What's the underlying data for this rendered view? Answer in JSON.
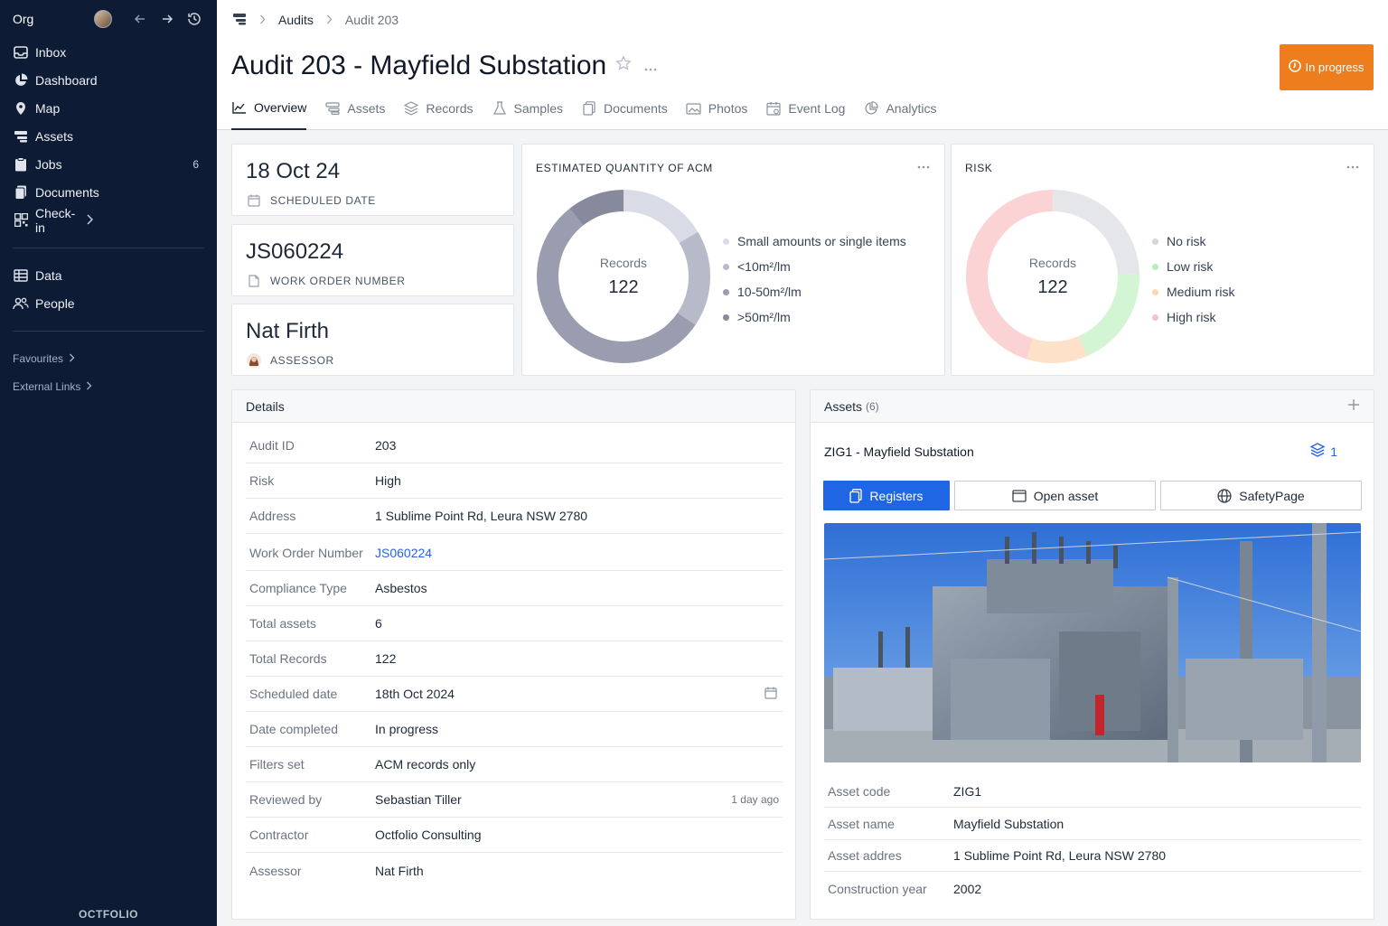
{
  "sidebar": {
    "org": "Org",
    "items": [
      {
        "label": "Inbox",
        "icon": "inbox-icon"
      },
      {
        "label": "Dashboard",
        "icon": "pie-chart-icon"
      },
      {
        "label": "Map",
        "icon": "map-pin-icon"
      },
      {
        "label": "Assets",
        "icon": "assets-icon"
      },
      {
        "label": "Jobs",
        "icon": "clipboard-icon",
        "count": "6"
      },
      {
        "label": "Documents",
        "icon": "documents-icon"
      },
      {
        "label": "Check-in",
        "icon": "qr-code-icon"
      }
    ],
    "items2": [
      {
        "label": "Data",
        "icon": "table-icon"
      },
      {
        "label": "People",
        "icon": "people-icon"
      }
    ],
    "favourites": "Favourites",
    "external_links": "External Links",
    "logo": "OCTFOLIO"
  },
  "breadcrumb": {
    "parent": "Audits",
    "current": "Audit 203"
  },
  "page": {
    "title": "Audit 203 - Mayfield Substation",
    "status": "In progress",
    "status_color": "#ee7d1d"
  },
  "tabs": [
    {
      "label": "Overview",
      "icon": "chart-icon",
      "active": true
    },
    {
      "label": "Assets",
      "icon": "assets-icon"
    },
    {
      "label": "Records",
      "icon": "layers-icon"
    },
    {
      "label": "Samples",
      "icon": "flask-icon"
    },
    {
      "label": "Documents",
      "icon": "documents-icon"
    },
    {
      "label": "Photos",
      "icon": "photos-icon"
    },
    {
      "label": "Event Log",
      "icon": "calendar-icon"
    },
    {
      "label": "Analytics",
      "icon": "analytics-icon"
    }
  ],
  "kpis": {
    "scheduled": {
      "value": "18 Oct 24",
      "label": "SCHEDULED DATE"
    },
    "work_order": {
      "value": "JS060224",
      "label": "WORK ORDER NUMBER"
    },
    "assessor": {
      "value": "Nat Firth",
      "label": "ASSESSOR"
    }
  },
  "chart_data": [
    {
      "type": "pie",
      "title": "ESTIMATED QUANTITY OF ACM",
      "center_label": "Records",
      "center_value": "122",
      "categories": [
        "Small amounts or single items",
        "<10m²/lm",
        "10-50m²/lm",
        ">50m²/lm"
      ],
      "values": [
        20,
        22,
        67,
        13
      ],
      "colors": [
        "#d9dbe6",
        "#b7bac8",
        "#9a9db0",
        "#868a9c"
      ]
    },
    {
      "type": "pie",
      "title": "RISK",
      "center_label": "Records",
      "center_value": "122",
      "categories": [
        "No risk",
        "Low risk",
        "Medium risk",
        "High risk"
      ],
      "values": [
        30,
        23,
        14,
        55
      ],
      "colors": [
        "#e5e6ea",
        "#d3f5d3",
        "#fde2c9",
        "#fbd3d4"
      ],
      "legend_colors": [
        "#d3d5dc",
        "#b5efb5",
        "#fcd7b1",
        "#f8c1c3"
      ]
    }
  ],
  "details": {
    "title": "Details",
    "rows": [
      {
        "k": "Audit ID",
        "v": "203"
      },
      {
        "k": "Risk",
        "v": "High"
      },
      {
        "k": "Address",
        "v": "1 Sublime Point Rd, Leura NSW 2780"
      },
      {
        "k": "Work Order Number",
        "v": "JS060224"
      },
      {
        "k": "Compliance Type",
        "v": "Asbestos"
      },
      {
        "k": "Total assets",
        "v": "6"
      },
      {
        "k": "Total Records",
        "v": "122"
      },
      {
        "k": "Scheduled date",
        "v": "18th Oct 2024"
      },
      {
        "k": "Date completed",
        "v": "In progress"
      },
      {
        "k": "Filters set",
        "v": "ACM records only"
      },
      {
        "k": "Reviewed by",
        "v": "Sebastian Tiller",
        "meta": "1 day ago"
      },
      {
        "k": "Contractor",
        "v": "Octfolio Consulting"
      },
      {
        "k": "Assessor",
        "v": "Nat Firth"
      }
    ]
  },
  "assets": {
    "title": "Assets",
    "count": "(6)",
    "asset_name": "ZIG1 - Mayfield Substation",
    "layers_count": "1",
    "buttons": {
      "registers": "Registers",
      "open_asset": "Open asset",
      "safety_page": "SafetyPage"
    },
    "rows": [
      {
        "k": "Asset code",
        "v": "ZIG1"
      },
      {
        "k": "Asset name",
        "v": "Mayfield Substation"
      },
      {
        "k": "Asset addres",
        "v": "1 Sublime Point Rd, Leura NSW 2780"
      },
      {
        "k": "Construction year",
        "v": "2002"
      }
    ]
  }
}
